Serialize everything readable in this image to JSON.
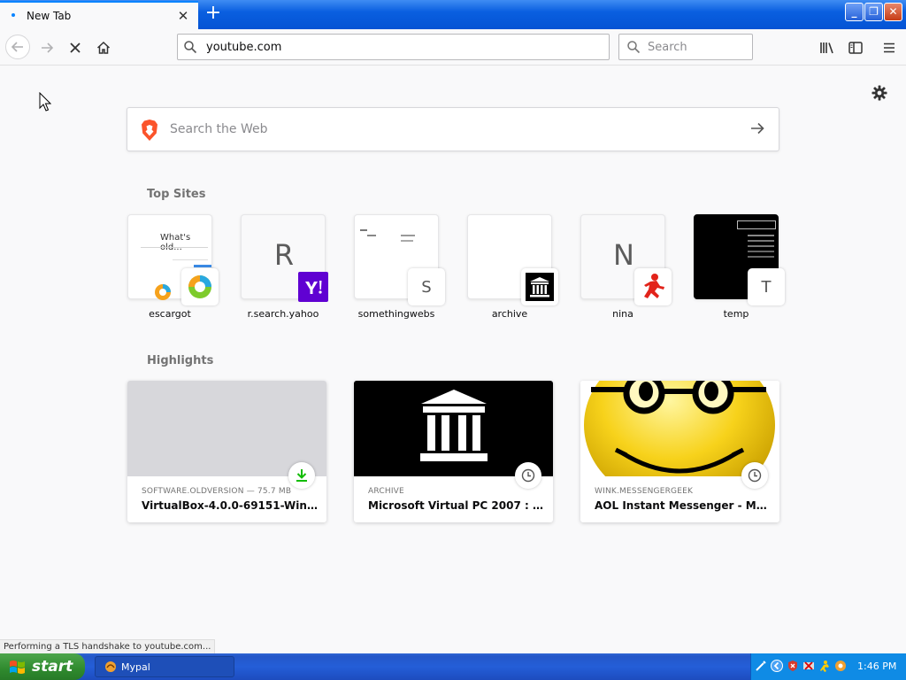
{
  "tab": {
    "title": "New Tab"
  },
  "toolbar": {
    "url_value": "youtube.com",
    "search_placeholder": "Search"
  },
  "content": {
    "web_search_placeholder": "Search the Web",
    "top_sites_title": "Top Sites",
    "highlights_title": "Highlights",
    "top_sites": [
      {
        "label": "escargot",
        "letter": "",
        "badge": "browser-logo-icon"
      },
      {
        "label": "r.search.yahoo",
        "letter": "R",
        "badge": "yahoo-icon"
      },
      {
        "label": "somethingwebs",
        "letter": "",
        "badge": "S"
      },
      {
        "label": "archive",
        "letter": "",
        "badge": "archive-icon"
      },
      {
        "label": "nina",
        "letter": "N",
        "badge": "aim-icon"
      },
      {
        "label": "temp",
        "letter": "",
        "badge": "T"
      }
    ],
    "escargot_preview_text": "What's old...",
    "highlights": [
      {
        "source": "SOFTWARE.OLDVERSION — 75.7 MB",
        "title": "VirtualBox-4.0.0-69151-Win.exe",
        "badge": "download-icon"
      },
      {
        "source": "ARCHIVE",
        "title": "Microsoft Virtual PC 2007 : Micr...",
        "badge": "clock-icon"
      },
      {
        "source": "WINK.MESSENGERGEEK",
        "title": "AOL Instant Messenger - Mess...",
        "badge": "clock-icon"
      }
    ]
  },
  "status_text": "Performing a TLS handshake to youtube.com...",
  "taskbar": {
    "start_label": "start",
    "task_label": "Mypal",
    "clock": "1:46 PM"
  },
  "colors": {
    "accent": "#0a84ff",
    "taskbar_blue": "#245ed8",
    "start_green": "#2f8a2e",
    "yahoo_purple": "#6001d2",
    "aim_red": "#e2231a",
    "download_green": "#12bc00"
  }
}
